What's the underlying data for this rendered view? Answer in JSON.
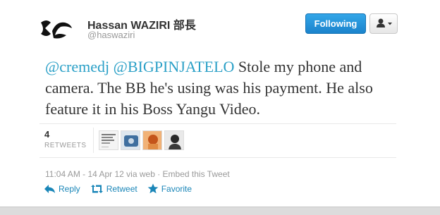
{
  "header": {
    "name": "Hassan WAZIRI 部長",
    "handle": "@haswaziri",
    "follow_label": "Following",
    "user_menu_icon": "person-dropdown-icon"
  },
  "tweet": {
    "mention1": "@cremedj",
    "mention2": "@BIGPINJATELO",
    "text": " Stole my phone and camera. The BB he's using was his payment. He also feature it in his Boss Yangu Video."
  },
  "stats": {
    "retweet_count": "4",
    "retweet_label": "RETWEETS"
  },
  "meta": {
    "line": "11:04 AM - 14 Apr 12 via web · Embed this Tweet"
  },
  "actions": {
    "reply": "Reply",
    "retweet": "Retweet",
    "favorite": "Favorite"
  },
  "colors": {
    "link": "#2ba0c7",
    "action": "#1a86b8",
    "follow_button": "#1b83cc"
  }
}
